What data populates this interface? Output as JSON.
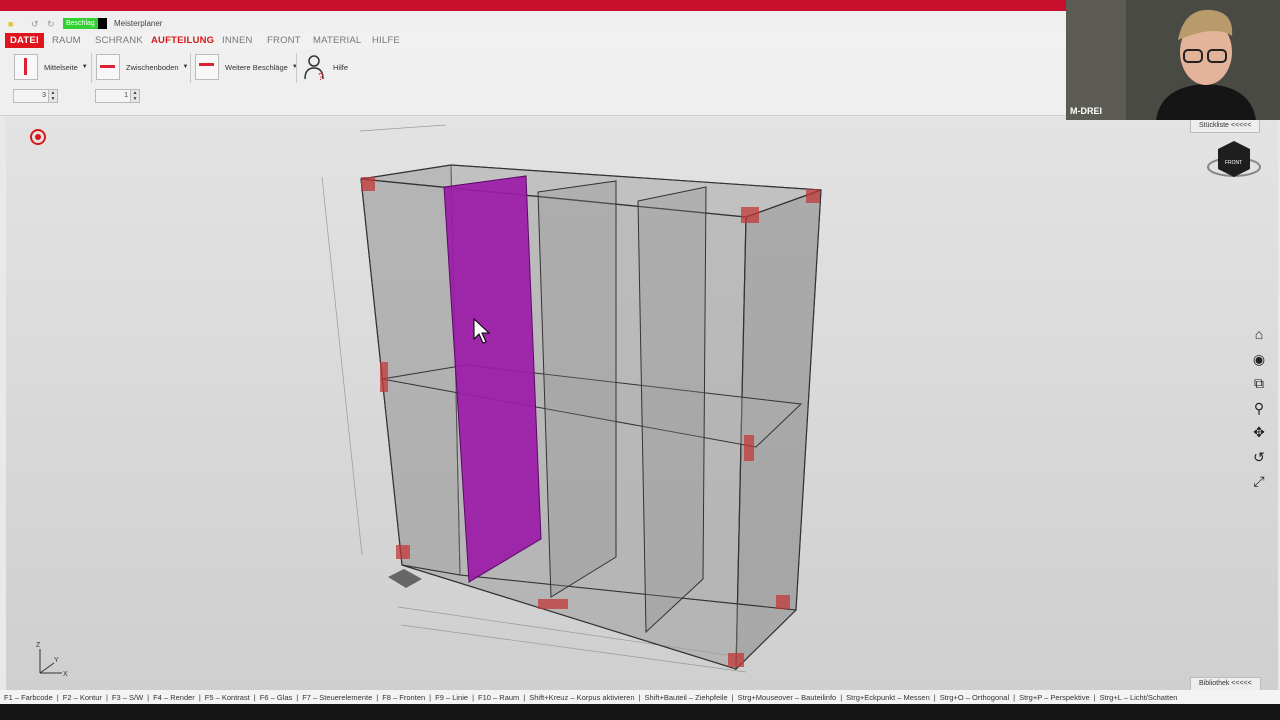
{
  "titlebar": {
    "badge": "Beschlag",
    "app_name": "Meisterplaner"
  },
  "menu": [
    "DATEI",
    "RAUM",
    "SCHRANK",
    "AUFTEILUNG",
    "INNEN",
    "FRONT",
    "MATERIAL",
    "HILFE"
  ],
  "ribbon": {
    "mittelseite": "Mittelseite",
    "zwischenboden": "Zwischenboden",
    "weitere": "Weitere Beschläge",
    "hilfe": "Hilfe",
    "spin1": "3",
    "spin2": "1"
  },
  "webcam_label": "M-DREI",
  "stueckliste": "Stückliste <<<<<",
  "bibliothek": "Bibliothek <<<<<",
  "navcube": "FRONT",
  "axis": {
    "z": "Z",
    "y": "Y",
    "x": "X"
  },
  "status": [
    "F1 – Farbcode",
    "F2 – Kontur",
    "F3 – S/W",
    "F4 – Render",
    "F5 – Kontrast",
    "F6 – Glas",
    "F7 – Steuerelemente",
    "F8 – Fronten",
    "F9 – Linie",
    "F10 – Raum",
    "Shift+Kreuz – Korpus aktivieren",
    "Shift+Bauteil – Ziehpfeile",
    "Strg+Mouseover – Bauteilinfo",
    "Strg+Eckpunkt – Messen",
    "Strg+O – Orthogonal",
    "Strg+P – Perspektive",
    "Strg+L – Licht/Schatten"
  ],
  "colors": {
    "accent": "#d81818",
    "selected_panel": "#9b1aa8"
  }
}
